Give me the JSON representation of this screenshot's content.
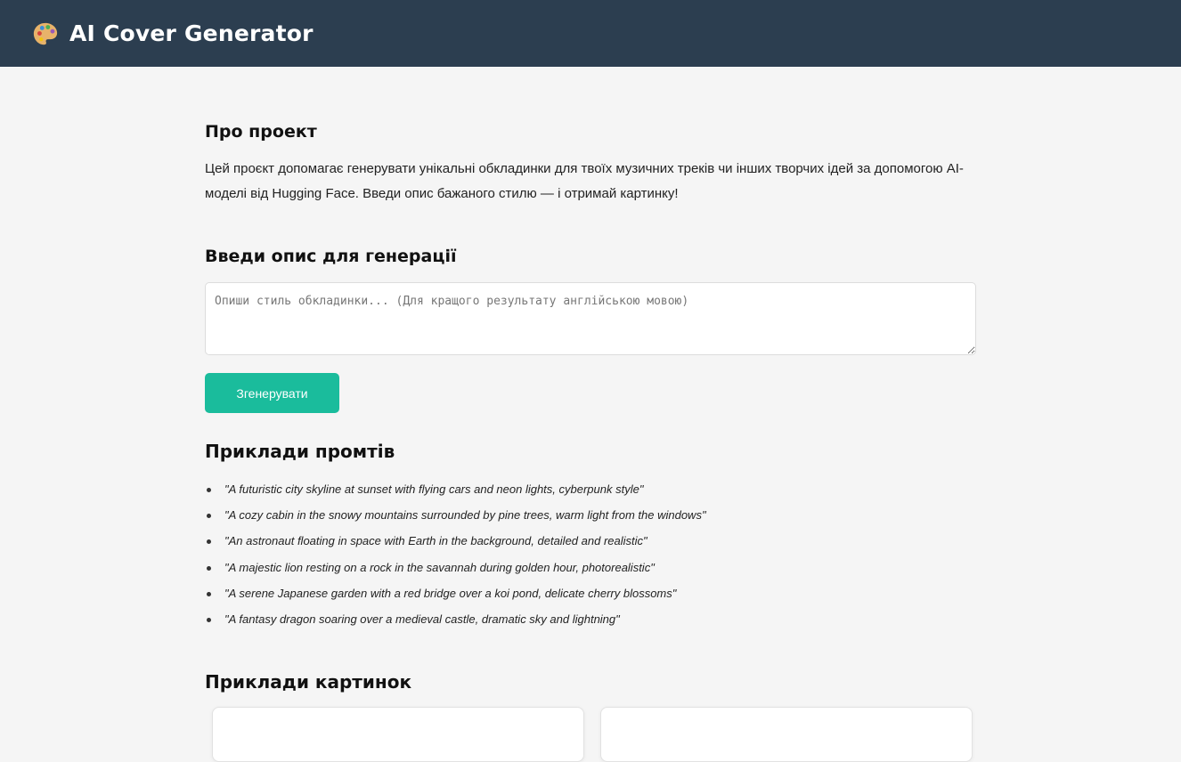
{
  "header": {
    "icon": "palette-icon",
    "title": "AI Cover Generator",
    "background_color": "#2c3e50"
  },
  "about": {
    "heading": "Про проект",
    "text": "Цей проєкт допомагає генерувати унікальні обкладинки для твоїх музичних треків чи інших творчих ідей за допомогою AI-моделі від Hugging Face. Введи опис бажаного стилю — і отримай картинку!"
  },
  "generator": {
    "heading": "Введи опис для генерації",
    "input_value": "",
    "input_placeholder": "Опиши стиль обкладинки... (Для кращого результату англійською мовою)",
    "button_label": "Згенерувати",
    "button_color": "#1abc9c"
  },
  "examples": {
    "heading": "Приклади промтів",
    "prompts": [
      "\"A futuristic city skyline at sunset with flying cars and neon lights, cyberpunk style\"",
      "\"A cozy cabin in the snowy mountains surrounded by pine trees, warm light from the windows\"",
      "\"An astronaut floating in space with Earth in the background, detailed and realistic\"",
      "\"A majestic lion resting on a rock in the savannah during golden hour, photorealistic\"",
      "\"A serene Japanese garden with a red bridge over a koi pond, delicate cherry blossoms\"",
      "\"A fantasy dragon soaring over a medieval castle, dramatic sky and lightning\""
    ]
  },
  "gallery": {
    "heading": "Приклади картинок",
    "card_count": 2
  }
}
